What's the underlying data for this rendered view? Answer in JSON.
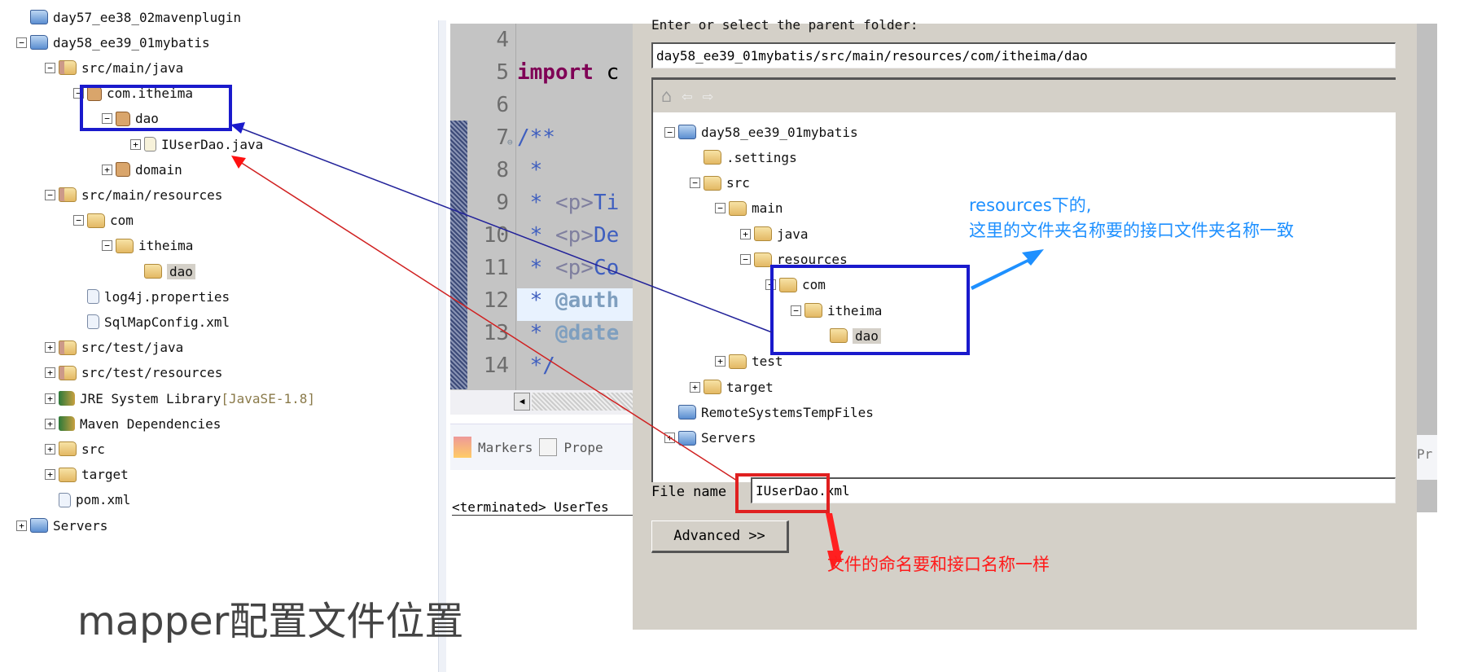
{
  "explorer": {
    "rows": [
      {
        "label": "day57_ee38_02mavenplugin",
        "level": 0,
        "toggle": "",
        "icon": "proj"
      },
      {
        "label": "day58_ee39_01mybatis",
        "level": 0,
        "toggle": "-",
        "icon": "proj"
      },
      {
        "label": "src/main/java",
        "level": 1,
        "toggle": "-",
        "icon": "srcf"
      },
      {
        "label": "com.itheima",
        "level": 2,
        "toggle": "-",
        "icon": "pkg"
      },
      {
        "label": "dao",
        "level": 3,
        "toggle": "-",
        "icon": "pkg"
      },
      {
        "label": "IUserDao.java",
        "level": 4,
        "toggle": "+",
        "icon": "java"
      },
      {
        "label": "domain",
        "level": 3,
        "toggle": "+",
        "icon": "pkg"
      },
      {
        "label": "src/main/resources",
        "level": 1,
        "toggle": "-",
        "icon": "srcf"
      },
      {
        "label": "com",
        "level": 2,
        "toggle": "-",
        "icon": "folder"
      },
      {
        "label": "itheima",
        "level": 3,
        "toggle": "-",
        "icon": "folder"
      },
      {
        "label": "dao",
        "level": 4,
        "toggle": "",
        "icon": "folder",
        "selected": true
      },
      {
        "label": "log4j.properties",
        "level": 2,
        "toggle": "",
        "icon": "file"
      },
      {
        "label": "SqlMapConfig.xml",
        "level": 2,
        "toggle": "",
        "icon": "file"
      },
      {
        "label": "src/test/java",
        "level": 1,
        "toggle": "+",
        "icon": "srcf"
      },
      {
        "label": "src/test/resources",
        "level": 1,
        "toggle": "+",
        "icon": "srcf"
      },
      {
        "label": "JRE System Library",
        "level": 1,
        "toggle": "+",
        "icon": "lib",
        "decoration": "[JavaSE-1.8]"
      },
      {
        "label": "Maven Dependencies",
        "level": 1,
        "toggle": "+",
        "icon": "lib"
      },
      {
        "label": "src",
        "level": 1,
        "toggle": "+",
        "icon": "folder"
      },
      {
        "label": "target",
        "level": 1,
        "toggle": "+",
        "icon": "folder"
      },
      {
        "label": "pom.xml",
        "level": 1,
        "toggle": "",
        "icon": "file"
      },
      {
        "label": "Servers",
        "level": 0,
        "toggle": "+",
        "icon": "proj"
      }
    ]
  },
  "editor": {
    "lines": [
      {
        "n": "4",
        "segs": []
      },
      {
        "n": "5",
        "segs": [
          {
            "t": "import ",
            "c": "#7f0055",
            "b": true
          },
          {
            "t": "c",
            "c": "#000"
          }
        ]
      },
      {
        "n": "6",
        "segs": []
      },
      {
        "n": "7",
        "segs": [
          {
            "t": "/**",
            "c": "#3f5fbf"
          }
        ],
        "fold": true
      },
      {
        "n": "8",
        "segs": [
          {
            "t": " *",
            "c": "#3f5fbf"
          }
        ]
      },
      {
        "n": "9",
        "segs": [
          {
            "t": " * ",
            "c": "#3f5fbf"
          },
          {
            "t": "<p>",
            "c": "#7f7f9f"
          },
          {
            "t": "Ti",
            "c": "#3f5fbf"
          }
        ]
      },
      {
        "n": "10",
        "segs": [
          {
            "t": " * ",
            "c": "#3f5fbf"
          },
          {
            "t": "<p>",
            "c": "#7f7f9f"
          },
          {
            "t": "De",
            "c": "#3f5fbf"
          }
        ]
      },
      {
        "n": "11",
        "segs": [
          {
            "t": " * ",
            "c": "#3f5fbf"
          },
          {
            "t": "<p>",
            "c": "#7f7f9f"
          },
          {
            "t": "Co",
            "c": "#3f5fbf"
          }
        ]
      },
      {
        "n": "12",
        "segs": [
          {
            "t": " * ",
            "c": "#3f5fbf"
          },
          {
            "t": "@auth",
            "c": "#7f9fbf",
            "b": true
          }
        ],
        "current": true
      },
      {
        "n": "13",
        "segs": [
          {
            "t": " * ",
            "c": "#3f5fbf"
          },
          {
            "t": "@date",
            "c": "#7f9fbf",
            "b": true
          }
        ]
      },
      {
        "n": "14",
        "segs": [
          {
            "t": " */",
            "c": "#3f5fbf"
          }
        ]
      }
    ]
  },
  "bottom_panel": {
    "tabs": [
      "Markers",
      "Prope"
    ],
    "console": "<terminated> UserTes"
  },
  "dialog": {
    "prompt": "Enter or select the parent folder:",
    "parent_folder": "day58_ee39_01mybatis/src/main/resources/com/itheima/dao",
    "tree": [
      {
        "label": "day58_ee39_01mybatis",
        "level": 0,
        "toggle": "-",
        "icon": "proj"
      },
      {
        "label": ".settings",
        "level": 1,
        "toggle": "",
        "icon": "folder"
      },
      {
        "label": "src",
        "level": 1,
        "toggle": "-",
        "icon": "folder"
      },
      {
        "label": "main",
        "level": 2,
        "toggle": "-",
        "icon": "folder"
      },
      {
        "label": "java",
        "level": 3,
        "toggle": "+",
        "icon": "folder"
      },
      {
        "label": "resources",
        "level": 3,
        "toggle": "-",
        "icon": "folder"
      },
      {
        "label": "com",
        "level": 4,
        "toggle": "-",
        "icon": "folder"
      },
      {
        "label": "itheima",
        "level": 5,
        "toggle": "-",
        "icon": "folder"
      },
      {
        "label": "dao",
        "level": 6,
        "toggle": "",
        "icon": "folder",
        "selected": true
      },
      {
        "label": "test",
        "level": 2,
        "toggle": "+",
        "icon": "folder"
      },
      {
        "label": "target",
        "level": 1,
        "toggle": "+",
        "icon": "folder"
      },
      {
        "label": "RemoteSystemsTempFiles",
        "level": 0,
        "toggle": "",
        "icon": "proj"
      },
      {
        "label": "Servers",
        "level": 0,
        "toggle": "+",
        "icon": "proj"
      }
    ],
    "file_name_label": "File name",
    "file_name": "IUserDao.xml",
    "advanced_label": "Advanced >>"
  },
  "right_strip_text": "Pr",
  "annotations": {
    "blue_note_line1": "resources下的,",
    "blue_note_line2": "这里的文件夹名称要的接口文件夹名称一致",
    "red_note": "文件的命名要和接口名称一样",
    "caption": "mapper配置文件位置",
    "blue": "#1a1acc",
    "red": "#e02020",
    "note_blue": "#1e90ff"
  }
}
